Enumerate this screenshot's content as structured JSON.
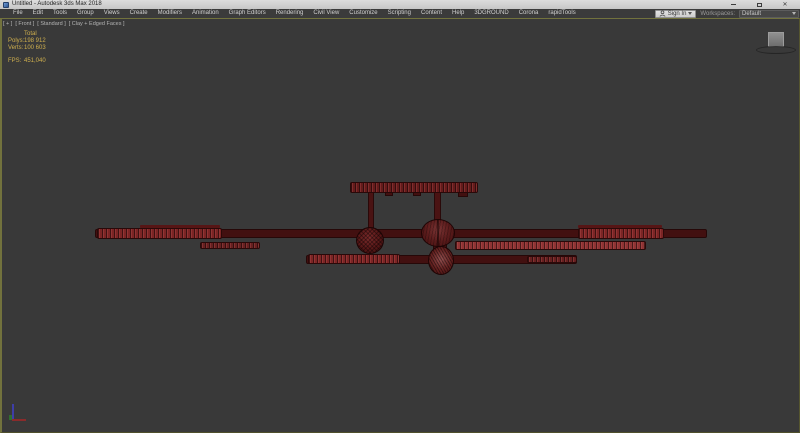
{
  "window": {
    "title": "Untitled - Autodesk 3ds Max 2018",
    "controls": {
      "minimize": "minimize",
      "restore": "restore",
      "close": "close"
    }
  },
  "menu_bar": {
    "items": [
      "File",
      "Edit",
      "Tools",
      "Group",
      "Views",
      "Create",
      "Modifiers",
      "Animation",
      "Graph Editors",
      "Rendering",
      "Civil View",
      "Customize",
      "Scripting",
      "Content",
      "Help",
      "3DGROUND",
      "Corona",
      "rapidTools"
    ],
    "sign_in_label": "Sign In",
    "workspaces_label": "Workspaces:",
    "workspace_value": "Default"
  },
  "viewport": {
    "label_parts": [
      "[ + ]",
      "[ Front ]",
      "[ Standard ]",
      "[ Clay + Edged Faces ]"
    ],
    "stats": {
      "header": "Total",
      "polys_label": "Polys:",
      "polys_value": "198 912",
      "verts_label": "Verts:",
      "verts_value": "100 603",
      "fps_label": "FPS:",
      "fps_value": "451,040"
    },
    "model_description": "front orthographic view of multi-wing aircraft, clay + edged faces shading",
    "colors": {
      "viewport_background": "#393939",
      "active_viewport_border": "#72723d",
      "stats_text": "#cfaf4e",
      "model_dark_red": "#421010",
      "model_mid_red": "#5e1717",
      "model_ribbed_red": "#7c2525",
      "model_bright_red": "#8f3434",
      "axis_x": "#8a2b2b",
      "axis_y": "#2f6e2f",
      "axis_z": "#3e3ea8"
    }
  }
}
